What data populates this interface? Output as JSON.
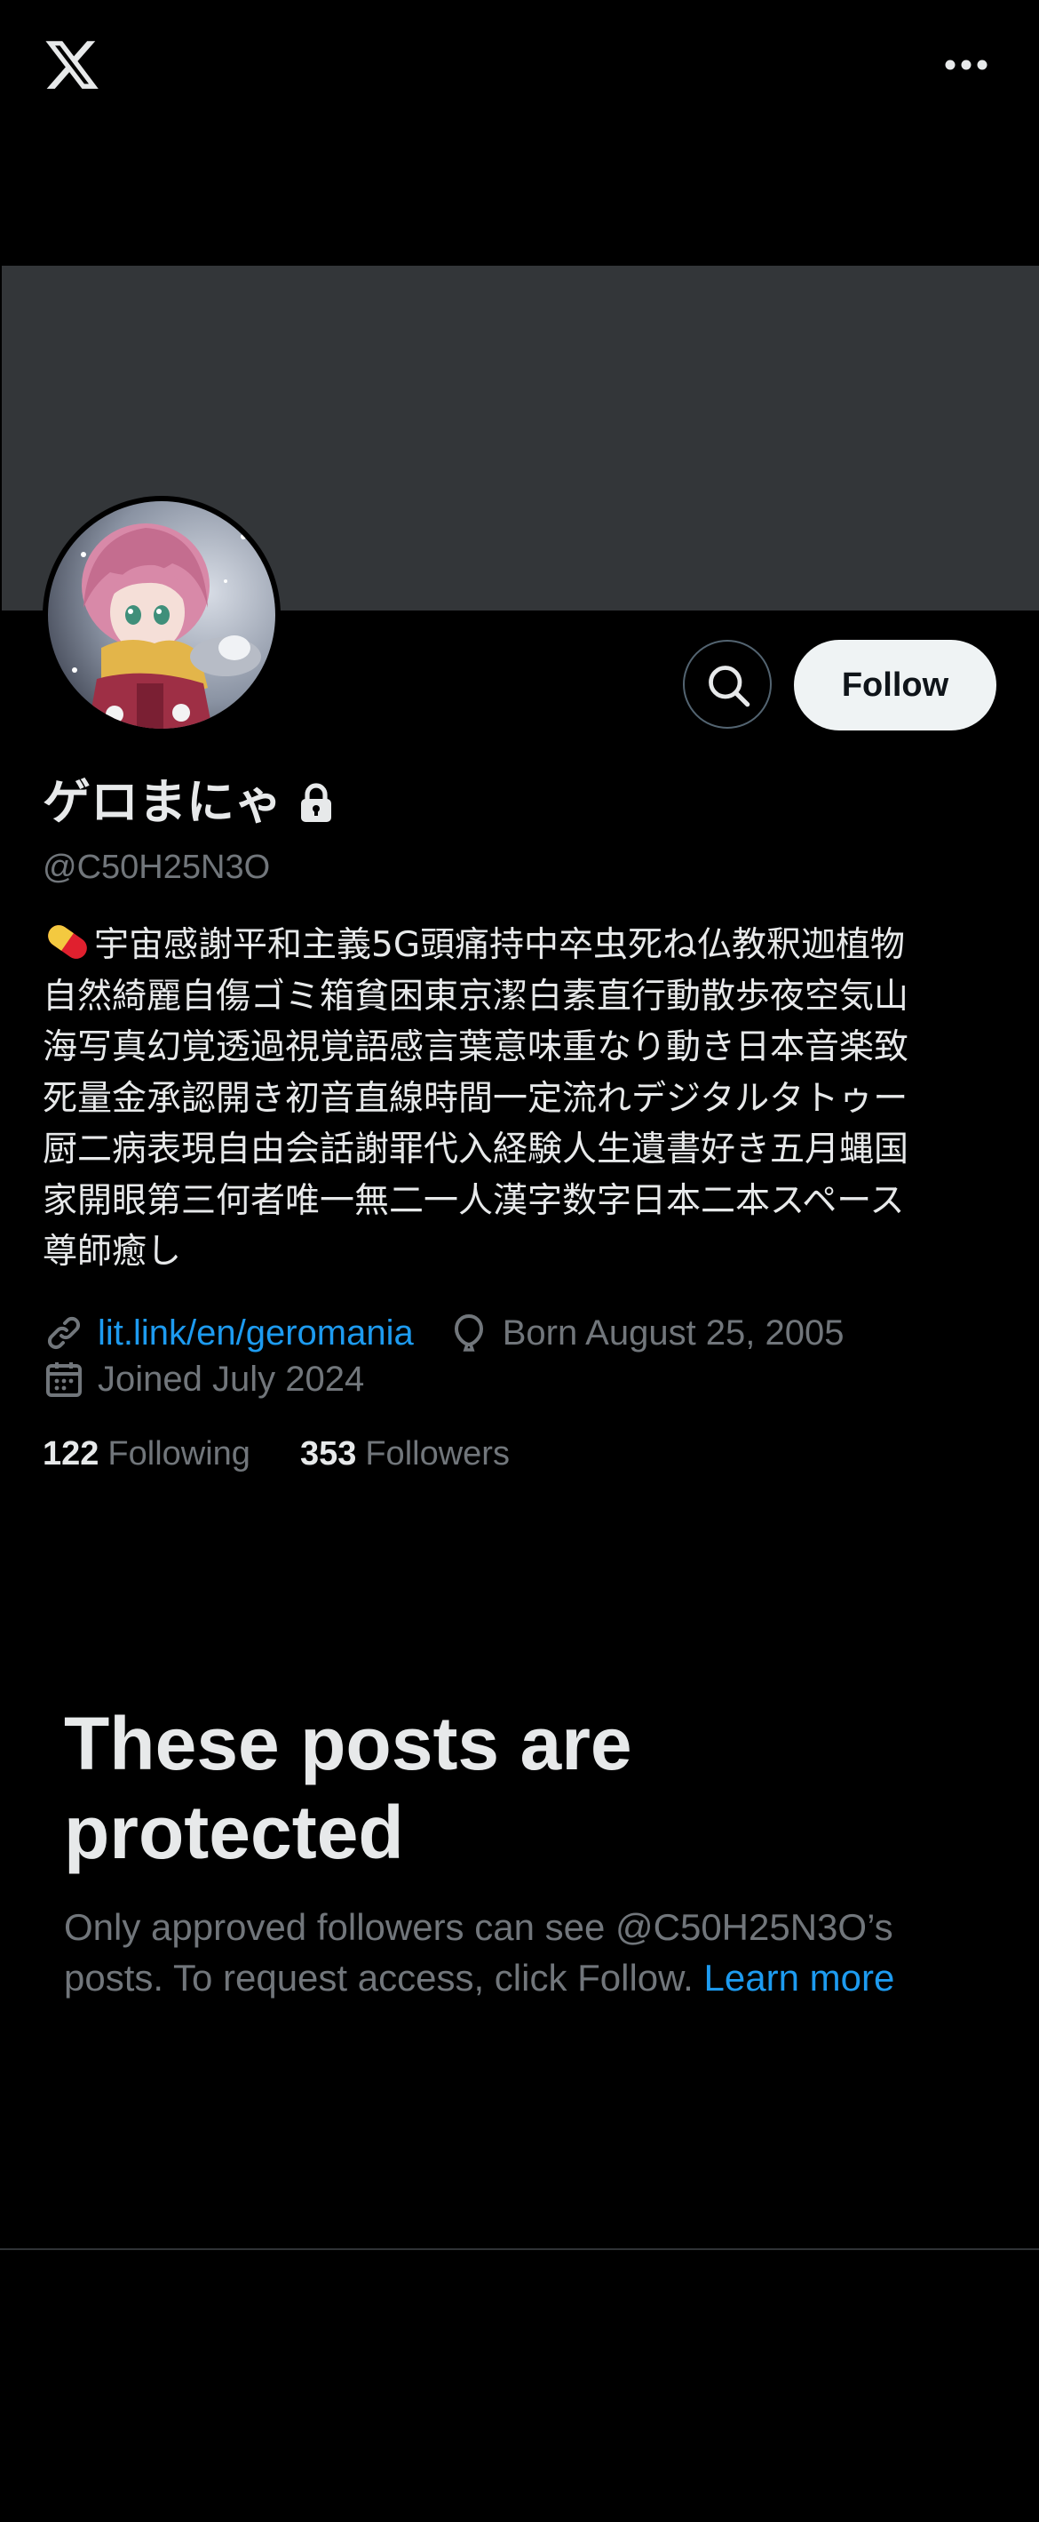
{
  "app": {
    "logo_icon": "x-logo-icon",
    "more_icon": "more-horizontal-icon"
  },
  "profile": {
    "display_name": "ゲロまにゃ",
    "handle": "@C50H25N3O",
    "protected_icon": "lock-icon",
    "follow_label": "Follow",
    "search_icon": "search-icon",
    "bio_emoji": "pill-icon",
    "bio": "宇宙感謝平和主義5G頭痛持中卒虫死ね仏教釈迦植物\n自然綺麗自傷ゴミ箱貧困東京潔白素直行動散歩夜空気山\n海写真幻覚透過視覚語感言葉意味重なり動き日本音楽致\n死量金承認開き初音直線時間一定流れデジタルタトゥー\n厨二病表現自由会話謝罪代入経験人生遺書好き五月蝿国\n家開眼第三何者唯一無二一人漢字数字日本二本スペース\n尊師癒し",
    "website": "lit.link/en/geromania",
    "birthday": "Born August 25, 2005",
    "joined": "Joined July 2024",
    "following_count": "122",
    "following_label": "Following",
    "followers_count": "353",
    "followers_label": "Followers"
  },
  "protected": {
    "title": "These posts are protected",
    "description": "Only approved followers can see @C50H25N3O’s posts. To request access, click Follow.",
    "learn_more": "Learn more"
  },
  "colors": {
    "background": "#000000",
    "banner": "#333639",
    "link": "#1d9bf0",
    "secondary_text": "#71767b",
    "primary_text": "#e7e9ea",
    "follow_button_bg": "#eff3f4"
  }
}
